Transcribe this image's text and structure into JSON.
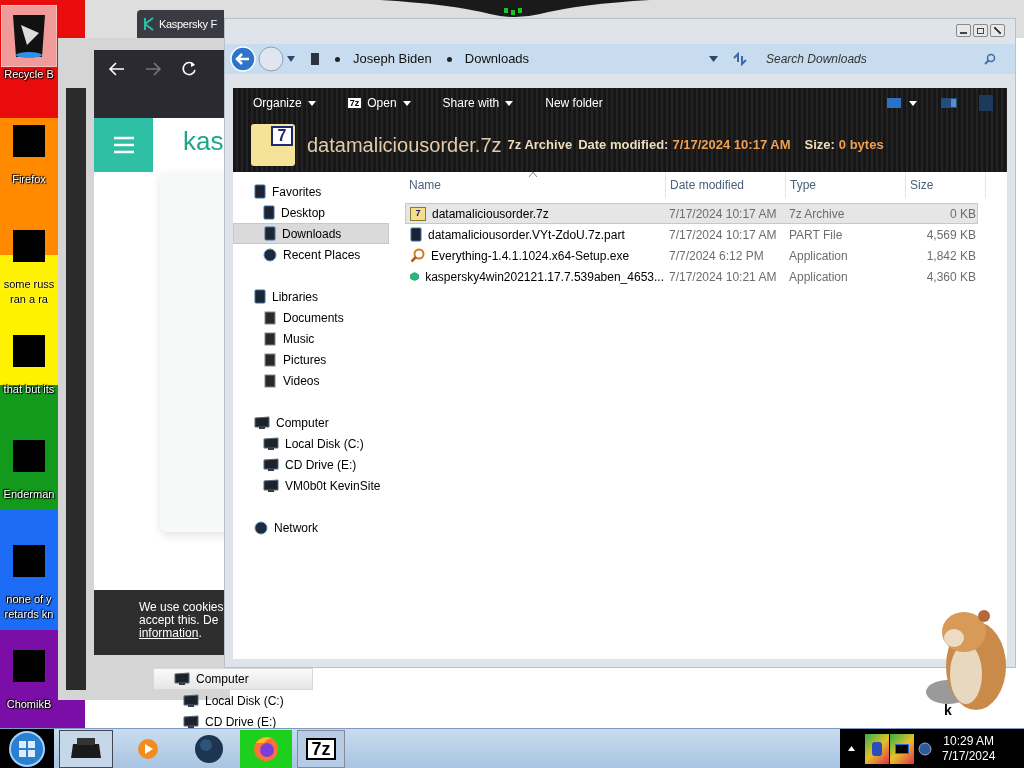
{
  "desktop": {
    "icons": [
      {
        "kind": "bin",
        "selected": true,
        "lines": [
          "Recycle B"
        ]
      },
      {
        "kind": "covered",
        "selected": false,
        "lines": [
          "Firefox"
        ]
      },
      {
        "kind": "covered",
        "selected": false,
        "lines": [
          "some russ",
          "ran a ra"
        ]
      },
      {
        "kind": "covered",
        "selected": false,
        "lines": [
          "that but its"
        ]
      },
      {
        "kind": "covered",
        "selected": false,
        "lines": [
          "Enderman"
        ]
      },
      {
        "kind": "covered",
        "selected": false,
        "lines": [
          "none of y",
          "retards kn"
        ]
      },
      {
        "kind": "covered",
        "selected": false,
        "lines": [
          "ChomikB"
        ]
      }
    ],
    "corner_label": "k"
  },
  "browser": {
    "tab_title": "Kaspersky F",
    "logo_text": "kas",
    "cookie_banner": {
      "lines": [
        "We use cookies",
        "accept this. De"
      ],
      "link": "information",
      "after_link": "."
    }
  },
  "back_explorer": {
    "items": [
      {
        "kind": "computer",
        "label": "Computer",
        "selected": true,
        "children": [
          {
            "kind": "disk",
            "label": "Local Disk (C:)",
            "selected": false
          },
          {
            "kind": "disk",
            "label": "CD Drive (E:)",
            "selected": false
          }
        ]
      }
    ]
  },
  "explorer": {
    "breadcrumbs": [
      "Joseph Biden",
      "Downloads"
    ],
    "search": {
      "placeholder": "Search Downloads"
    },
    "toolbar": [
      {
        "label": "Organize",
        "dropdown": true
      },
      {
        "label": "Open",
        "icon_text": "7z",
        "dropdown": true
      },
      {
        "label": "Share with",
        "dropdown": true
      },
      {
        "label": "New folder",
        "dropdown": false
      }
    ],
    "details": {
      "name": "datamaliciousorder.7z",
      "icon_text": "7",
      "type": "7z Archive",
      "date_label": "Date modified:",
      "date": "7/17/2024 10:17 AM",
      "size_label": "Size:",
      "size": "0 bytes"
    },
    "nav": [
      {
        "kind": "favorites",
        "label": "Favorites",
        "selected": false,
        "children": [
          {
            "kind": "desktop",
            "label": "Desktop",
            "selected": false
          },
          {
            "kind": "downloads",
            "label": "Downloads",
            "selected": true
          },
          {
            "kind": "recent",
            "label": "Recent Places",
            "selected": false
          }
        ]
      },
      {
        "kind": "libraries",
        "label": "Libraries",
        "selected": false,
        "children": [
          {
            "kind": "documents",
            "label": "Documents",
            "selected": false
          },
          {
            "kind": "music",
            "label": "Music",
            "selected": false
          },
          {
            "kind": "pictures",
            "label": "Pictures",
            "selected": false
          },
          {
            "kind": "videos",
            "label": "Videos",
            "selected": false
          }
        ]
      },
      {
        "kind": "computer",
        "label": "Computer",
        "selected": false,
        "children": [
          {
            "kind": "disk",
            "label": "Local Disk (C:)",
            "selected": false
          },
          {
            "kind": "disk",
            "label": "CD Drive (E:)",
            "selected": false
          },
          {
            "kind": "netdrive",
            "label": "VM0b0t KevinSite",
            "selected": false
          }
        ]
      },
      {
        "kind": "network",
        "label": "Network",
        "selected": false
      }
    ],
    "columns": [
      "Name",
      "Date modified",
      "Type",
      "Size"
    ],
    "rows": [
      {
        "kind": "archive",
        "icon_text": "7",
        "name": "datamaliciousorder.7z",
        "date": "7/17/2024 10:17 AM",
        "type": "7z Archive",
        "size": "0 KB",
        "selected": true
      },
      {
        "kind": "part",
        "name": "datamaliciousorder.VYt-ZdoU.7z.part",
        "date": "7/17/2024 10:17 AM",
        "type": "PART File",
        "size": "4,569 KB",
        "selected": false
      },
      {
        "kind": "search",
        "name": "Everything-1.4.1.1024.x64-Setup.exe",
        "date": "7/7/2024 6:12 PM",
        "type": "Application",
        "size": "1,842 KB",
        "selected": false
      },
      {
        "kind": "cube",
        "name": "kaspersky4win202121.17.7.539aben_4653...",
        "date": "7/17/2024 10:21 AM",
        "type": "Application",
        "size": "4,360 KB",
        "selected": false
      }
    ]
  },
  "taskbar": {
    "buttons": [
      {
        "kind": "printer",
        "active": true
      },
      {
        "kind": "media",
        "active": false
      },
      {
        "kind": "globe",
        "active": false
      },
      {
        "kind": "firefox",
        "active": false
      },
      {
        "kind": "sevenzip",
        "active": false,
        "label": "7z"
      }
    ],
    "clock": {
      "time": "10:29 AM",
      "date": "7/17/2024"
    }
  }
}
